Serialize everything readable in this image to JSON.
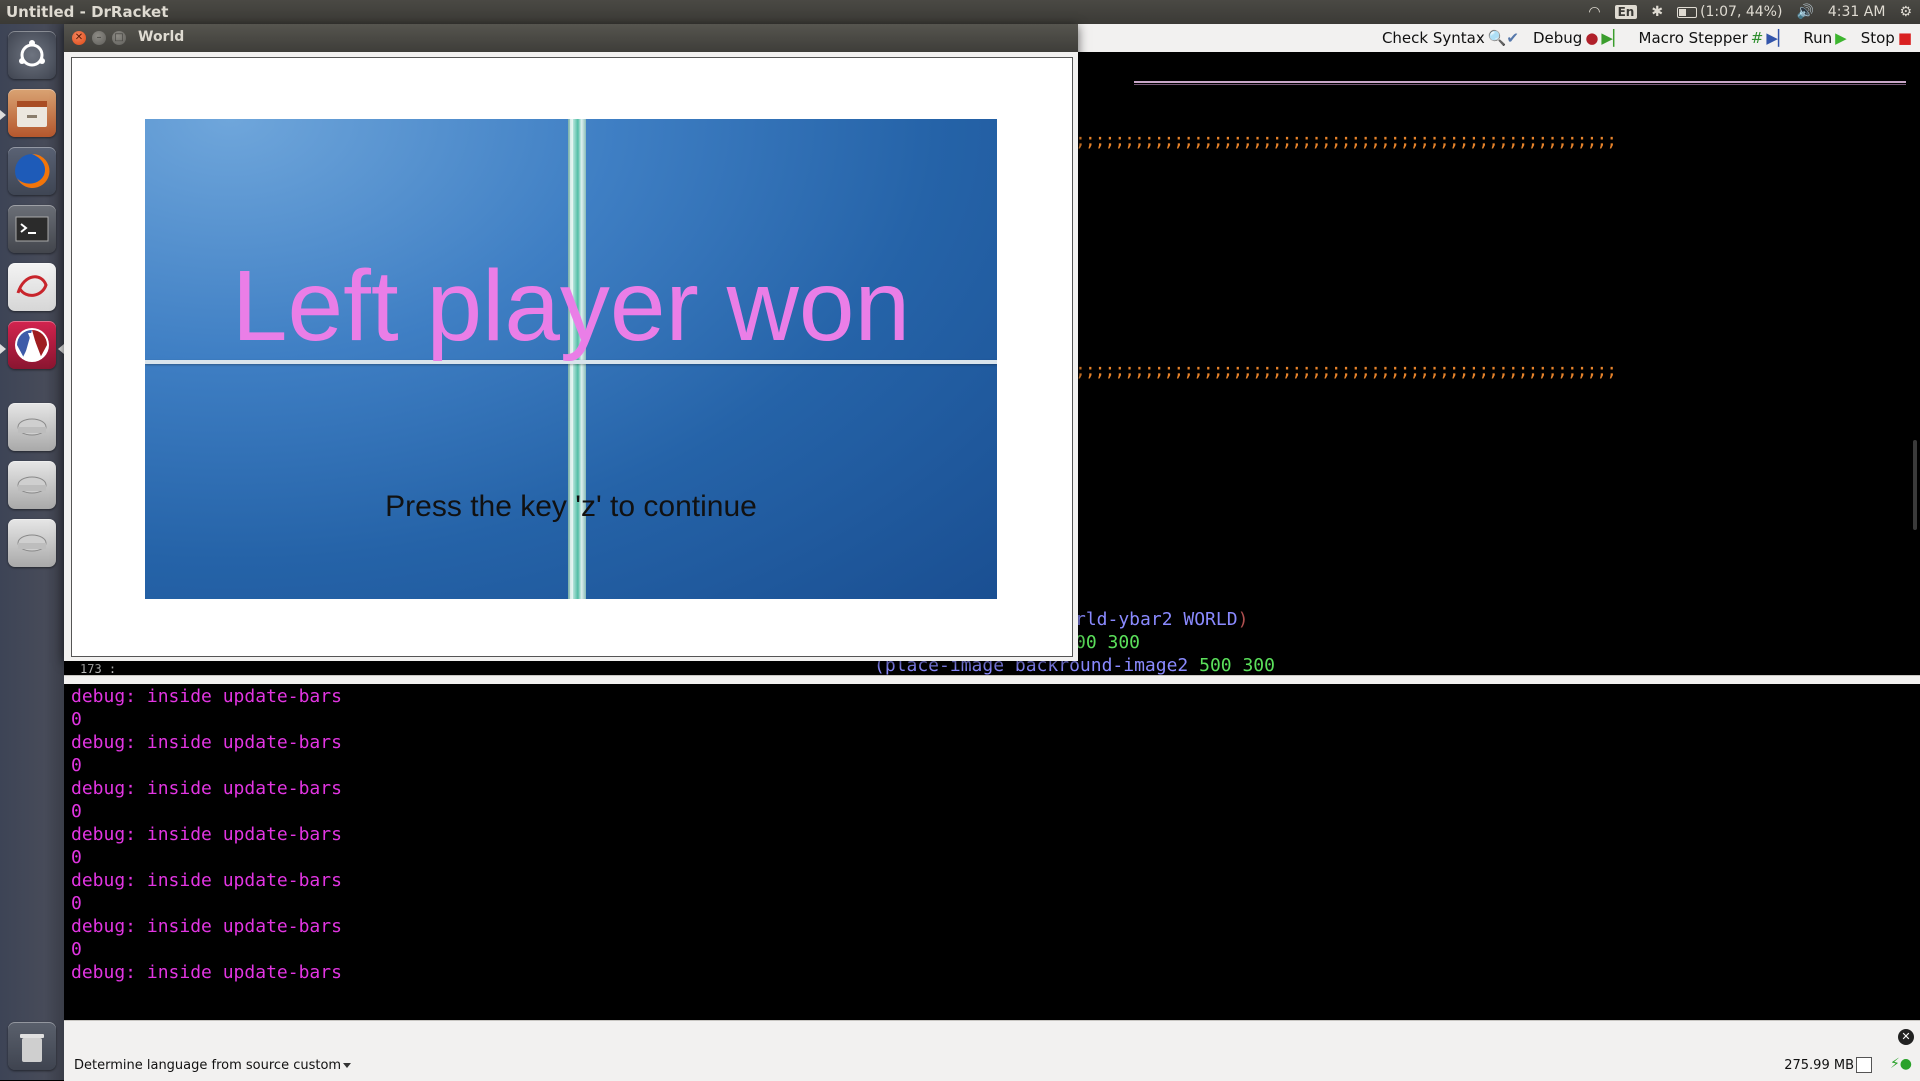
{
  "top_panel": {
    "app_title": "Untitled - DrRacket",
    "keyboard": "En",
    "battery": "(1:07, 44%)",
    "clock": "4:31 AM"
  },
  "launcher": {
    "items": [
      "dash-home",
      "files",
      "firefox",
      "terminal",
      "libreoffice-draw",
      "drracket",
      "drive",
      "drive",
      "drive",
      "trash"
    ]
  },
  "toolbar": {
    "check_syntax": "Check Syntax",
    "debug": "Debug",
    "macro_stepper": "Macro Stepper",
    "run": "Run",
    "stop": "Stop"
  },
  "definitions": {
    "line1": ";;;;;;;;;;;;;;;;;;;;;;;;;;;;;;;;;;;;;;;;;;;;;;;;;;;;;;;",
    "line2": ";;;;;;;;;;;;;;;;;;;;;;;;;;;;;;;;;;;;;;;;;;;;;;;;;;;;;;;",
    "code_ident": "rld-ybar2 WORLD",
    "code_paren": ")",
    "code_nums": "00 300",
    "code_partial_ident": "(place-image backround-image2",
    "code_partial_nums": " 500 300",
    "line_indicator": "173 :"
  },
  "interactions": {
    "lines": [
      "debug: inside update-bars",
      "0",
      "debug: inside update-bars",
      "0",
      "debug: inside update-bars",
      "0",
      "debug: inside update-bars",
      "0",
      "debug: inside update-bars",
      "0",
      "debug: inside update-bars",
      "0",
      "debug: inside update-bars"
    ]
  },
  "status": {
    "language": "Determine language from source custom",
    "memory": "275.99 MB"
  },
  "world_window": {
    "title": "World",
    "message": "Left player won",
    "prompt": "Press the key 'z' to continue"
  },
  "colors": {
    "message": "#ea7ee7",
    "debug_output": "#e235e2",
    "comment": "#e8842b",
    "identifier": "#8a8aff",
    "number": "#5be05b"
  }
}
